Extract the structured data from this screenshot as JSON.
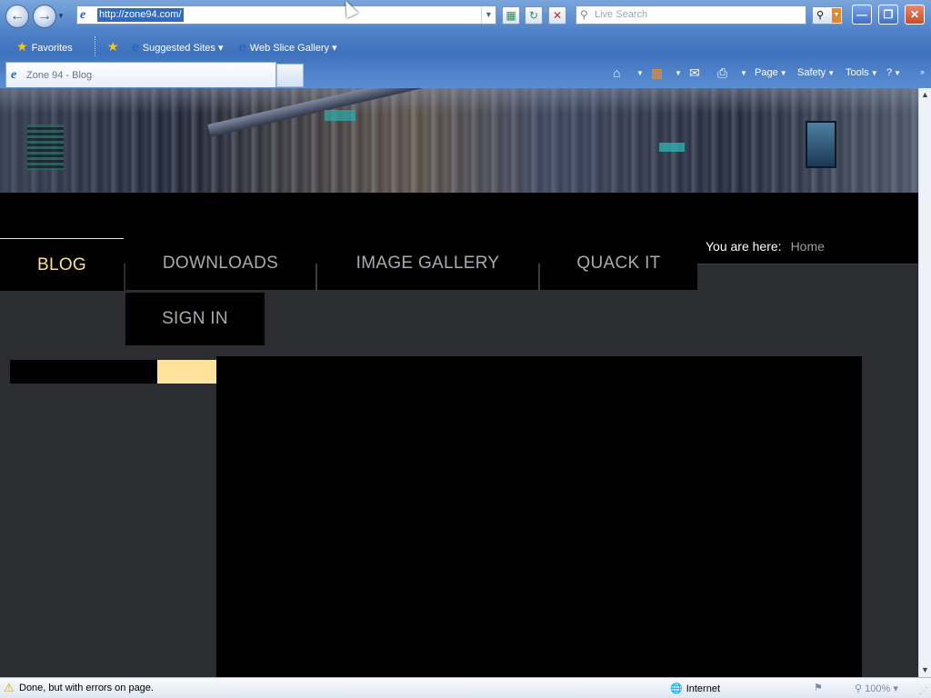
{
  "browser": {
    "address": {
      "url": "http://zone94.com/"
    },
    "search": {
      "placeholder": "Live Search"
    },
    "favorites_bar": {
      "favorites_label": "Favorites",
      "suggested_sites": "Suggested Sites",
      "web_slice_gallery": "Web Slice Gallery"
    },
    "tab": {
      "title": "Zone 94 - Blog"
    },
    "commands": {
      "page": "Page",
      "safety": "Safety",
      "tools": "Tools",
      "help": "?"
    }
  },
  "site": {
    "nav": {
      "blog": "BLOG",
      "downloads": "DOWNLOADS",
      "image_gallery": "IMAGE GALLERY",
      "quack_it": "QUACK IT",
      "sign_in": "SIGN IN"
    },
    "breadcrumb": {
      "label": "You are here:",
      "home": "Home"
    },
    "colors": {
      "accent": "#ffe29b",
      "active_nav": "#ffe08a",
      "background": "#2b2d30"
    }
  },
  "status_bar": {
    "message": "Done, but with errors on page.",
    "zone": "Internet",
    "zoom": "100%"
  }
}
